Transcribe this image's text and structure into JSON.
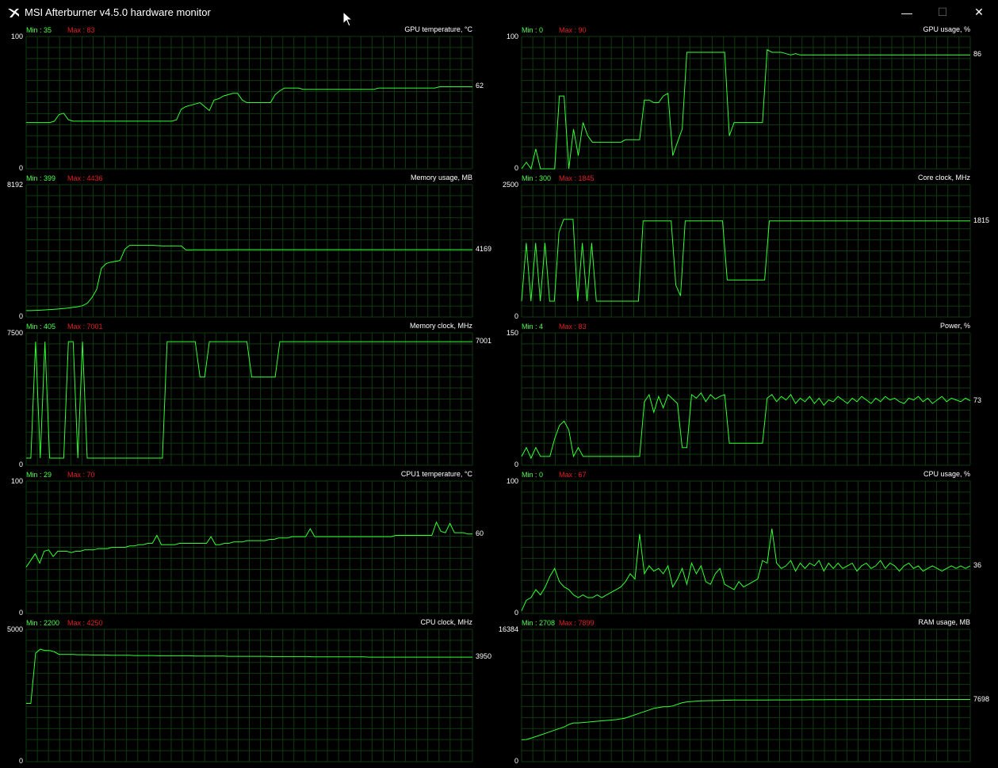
{
  "window": {
    "title": "MSI Afterburner v4.5.0 hardware monitor",
    "controls": {
      "minimize": "—",
      "maximize": "☐",
      "close": "✕"
    },
    "icon": "afterburner-logo-icon"
  },
  "colors": {
    "line": "#33ff33",
    "grid": "#0f3a0f",
    "min": "#4cff4c",
    "max": "#e02020",
    "text": "#ffffff",
    "background": "#000000"
  },
  "graphs": [
    {
      "name": "GPU temperature, °C",
      "min_label": "Min : 35",
      "max_label": "Max : 83",
      "y_max_label": "100",
      "y_min_label": "0",
      "current_label": "62",
      "y_max": 100,
      "samples": [
        35,
        35,
        35,
        35,
        35,
        35,
        36,
        41,
        42,
        37,
        36,
        36,
        36,
        36,
        36,
        36,
        36,
        36,
        36,
        36,
        36,
        36,
        36,
        36,
        36,
        36,
        36,
        36,
        36,
        36,
        36,
        36,
        37,
        45,
        47,
        48,
        49,
        50,
        47,
        44,
        52,
        53,
        55,
        56,
        57,
        57,
        52,
        50,
        50,
        50,
        50,
        50,
        50,
        56,
        59,
        61,
        61,
        61,
        61,
        60,
        60,
        60,
        60,
        60,
        60,
        60,
        60,
        60,
        60,
        60,
        60,
        60,
        60,
        60,
        60,
        61,
        61,
        61,
        61,
        61,
        61,
        61,
        61,
        61,
        61,
        61,
        61,
        61,
        62,
        62,
        62,
        62,
        62,
        62,
        62,
        62
      ]
    },
    {
      "name": "GPU usage, %",
      "min_label": "Min : 0",
      "max_label": "Max : 90",
      "y_max_label": "100",
      "y_min_label": "0",
      "current_label": "86",
      "y_max": 100,
      "samples": [
        0,
        5,
        0,
        15,
        0,
        0,
        0,
        0,
        55,
        55,
        0,
        30,
        10,
        35,
        25,
        20,
        20,
        20,
        20,
        20,
        20,
        20,
        22,
        22,
        22,
        22,
        52,
        52,
        50,
        50,
        55,
        57,
        10,
        20,
        30,
        88,
        88,
        88,
        88,
        88,
        88,
        88,
        88,
        88,
        25,
        35,
        35,
        35,
        35,
        35,
        35,
        35,
        90,
        88,
        88,
        88,
        87,
        86,
        87,
        86,
        86,
        86,
        86,
        86,
        86,
        86,
        86,
        86,
        86,
        86,
        86,
        86,
        86,
        86,
        86,
        86,
        86,
        86,
        86,
        86,
        86,
        86,
        86,
        86,
        86,
        86,
        86,
        86,
        86,
        86,
        86,
        86,
        86,
        86,
        86,
        86
      ]
    },
    {
      "name": "Memory usage, MB",
      "min_label": "Min : 399",
      "max_label": "Max : 4436",
      "y_max_label": "8192",
      "y_min_label": "0",
      "current_label": "4169",
      "y_max": 8192,
      "samples": [
        399,
        399,
        410,
        420,
        440,
        460,
        480,
        500,
        530,
        560,
        600,
        640,
        700,
        850,
        1200,
        1700,
        3000,
        3300,
        3400,
        3450,
        3500,
        4200,
        4436,
        4436,
        4436,
        4436,
        4436,
        4436,
        4420,
        4400,
        4400,
        4400,
        4400,
        4400,
        4160,
        4160,
        4165,
        4165,
        4165,
        4165,
        4165,
        4165,
        4165,
        4165,
        4168,
        4168,
        4168,
        4168,
        4169,
        4169,
        4169,
        4169,
        4169,
        4169,
        4169,
        4169,
        4169,
        4169,
        4169,
        4169,
        4169,
        4169,
        4169,
        4169,
        4169,
        4169,
        4169,
        4169,
        4169,
        4169,
        4169,
        4169,
        4169,
        4169,
        4169,
        4169,
        4169,
        4169,
        4169,
        4169,
        4169,
        4169,
        4169,
        4169,
        4169,
        4169,
        4169,
        4169,
        4169,
        4169,
        4169,
        4169,
        4169,
        4169,
        4169,
        4169
      ]
    },
    {
      "name": "Core clock, MHz",
      "min_label": "Min : 300",
      "max_label": "Max : 1845",
      "y_max_label": "2500",
      "y_min_label": "0",
      "current_label": "1815",
      "y_max": 2500,
      "samples": [
        300,
        1400,
        300,
        1400,
        300,
        1400,
        300,
        300,
        1600,
        1845,
        1845,
        1845,
        300,
        1400,
        300,
        1400,
        300,
        300,
        300,
        300,
        300,
        300,
        300,
        300,
        300,
        300,
        1815,
        1815,
        1815,
        1815,
        1815,
        1815,
        1815,
        600,
        400,
        1815,
        1815,
        1815,
        1815,
        1815,
        1815,
        1815,
        1815,
        1815,
        700,
        700,
        700,
        700,
        700,
        700,
        700,
        700,
        700,
        1815,
        1815,
        1815,
        1815,
        1815,
        1815,
        1815,
        1815,
        1815,
        1815,
        1815,
        1815,
        1815,
        1815,
        1815,
        1815,
        1815,
        1815,
        1815,
        1815,
        1815,
        1815,
        1815,
        1815,
        1815,
        1815,
        1815,
        1815,
        1815,
        1815,
        1815,
        1815,
        1815,
        1815,
        1815,
        1815,
        1815,
        1815,
        1815,
        1815,
        1815,
        1815,
        1815,
        1815
      ]
    },
    {
      "name": "Memory clock, MHz",
      "min_label": "Min : 405",
      "max_label": "Max : 7001",
      "y_max_label": "7500",
      "y_min_label": "0",
      "current_label": "7001",
      "y_max": 7500,
      "samples": [
        405,
        405,
        7001,
        405,
        7001,
        405,
        405,
        405,
        405,
        7001,
        7001,
        405,
        7001,
        405,
        405,
        405,
        405,
        405,
        405,
        405,
        405,
        405,
        405,
        405,
        405,
        405,
        405,
        405,
        405,
        405,
        7001,
        7001,
        7001,
        7001,
        7001,
        7001,
        7001,
        5000,
        5000,
        7001,
        7001,
        7001,
        7001,
        7001,
        7001,
        7001,
        7001,
        7001,
        5000,
        5000,
        5000,
        5000,
        5000,
        5000,
        7001,
        7001,
        7001,
        7001,
        7001,
        7001,
        7001,
        7001,
        7001,
        7001,
        7001,
        7001,
        7001,
        7001,
        7001,
        7001,
        7001,
        7001,
        7001,
        7001,
        7001,
        7001,
        7001,
        7001,
        7001,
        7001,
        7001,
        7001,
        7001,
        7001,
        7001,
        7001,
        7001,
        7001,
        7001,
        7001,
        7001,
        7001,
        7001,
        7001,
        7001,
        7001
      ]
    },
    {
      "name": "Power, %",
      "min_label": "Min : 4",
      "max_label": "Max : 83",
      "y_max_label": "150",
      "y_min_label": "0",
      "current_label": "73",
      "y_max": 150,
      "samples": [
        10,
        20,
        8,
        20,
        10,
        10,
        10,
        30,
        45,
        50,
        40,
        10,
        20,
        10,
        10,
        10,
        10,
        10,
        10,
        10,
        10,
        10,
        10,
        10,
        10,
        10,
        72,
        80,
        60,
        78,
        65,
        80,
        75,
        70,
        20,
        20,
        80,
        76,
        82,
        72,
        80,
        75,
        78,
        80,
        25,
        25,
        25,
        25,
        25,
        25,
        25,
        25,
        76,
        80,
        72,
        78,
        74,
        80,
        70,
        76,
        72,
        78,
        70,
        76,
        68,
        74,
        72,
        78,
        74,
        70,
        76,
        72,
        78,
        74,
        70,
        76,
        72,
        78,
        74,
        76,
        72,
        70,
        76,
        74,
        78,
        72,
        76,
        70,
        74,
        78,
        72,
        76,
        74,
        72,
        76,
        73
      ]
    },
    {
      "name": "CPU1 temperature, °C",
      "min_label": "Min : 29",
      "max_label": "Max : 70",
      "y_max_label": "100",
      "y_min_label": "0",
      "current_label": "60",
      "y_max": 100,
      "samples": [
        35,
        40,
        45,
        38,
        47,
        48,
        43,
        47,
        47,
        47,
        46,
        47,
        47,
        48,
        48,
        48,
        49,
        49,
        49,
        50,
        50,
        50,
        50,
        51,
        51,
        52,
        52,
        53,
        53,
        59,
        52,
        52,
        52,
        52,
        53,
        53,
        53,
        53,
        53,
        53,
        53,
        58,
        52,
        52,
        53,
        53,
        54,
        54,
        54,
        55,
        55,
        55,
        55,
        55,
        56,
        56,
        57,
        57,
        57,
        58,
        58,
        58,
        58,
        64,
        58,
        58,
        58,
        58,
        58,
        58,
        58,
        58,
        58,
        58,
        58,
        58,
        58,
        58,
        58,
        58,
        58,
        58,
        59,
        59,
        59,
        59,
        59,
        59,
        59,
        59,
        59,
        69,
        62,
        61,
        68,
        61,
        61,
        61,
        60,
        60
      ]
    },
    {
      "name": "CPU usage, %",
      "min_label": "Min : 0",
      "max_label": "Max : 67",
      "y_max_label": "100",
      "y_min_label": "0",
      "current_label": "36",
      "y_max": 100,
      "samples": [
        2,
        10,
        12,
        18,
        14,
        20,
        28,
        34,
        24,
        20,
        18,
        14,
        12,
        14,
        12,
        12,
        14,
        12,
        14,
        16,
        18,
        20,
        24,
        30,
        26,
        60,
        30,
        36,
        32,
        34,
        30,
        36,
        20,
        26,
        34,
        22,
        38,
        30,
        36,
        24,
        22,
        30,
        34,
        22,
        20,
        18,
        24,
        20,
        22,
        24,
        26,
        40,
        38,
        64,
        38,
        34,
        36,
        40,
        32,
        38,
        34,
        38,
        36,
        40,
        32,
        38,
        34,
        38,
        34,
        36,
        38,
        32,
        36,
        38,
        34,
        36,
        40,
        34,
        38,
        36,
        32,
        36,
        38,
        34,
        36,
        32,
        34,
        36,
        34,
        32,
        34,
        36,
        34,
        36,
        34,
        36
      ]
    },
    {
      "name": "CPU clock, MHz",
      "min_label": "Min : 2200",
      "max_label": "Max : 4250",
      "y_max_label": "5000",
      "y_min_label": "0",
      "current_label": "3950",
      "y_max": 5000,
      "samples": [
        2200,
        2200,
        4100,
        4250,
        4200,
        4200,
        4150,
        4050,
        4050,
        4050,
        4050,
        4040,
        4040,
        4040,
        4030,
        4030,
        4030,
        4030,
        4020,
        4020,
        4020,
        4020,
        4020,
        4010,
        4010,
        4010,
        4010,
        4010,
        4000,
        4000,
        4000,
        4000,
        4000,
        4000,
        4000,
        4000,
        3990,
        3990,
        3990,
        3990,
        3990,
        3990,
        3990,
        3980,
        3980,
        3980,
        3980,
        3980,
        3980,
        3980,
        3980,
        3980,
        3970,
        3970,
        3970,
        3970,
        3970,
        3970,
        3970,
        3970,
        3970,
        3960,
        3960,
        3960,
        3960,
        3960,
        3960,
        3960,
        3960,
        3960,
        3960,
        3960,
        3960,
        3950,
        3950,
        3950,
        3950,
        3950,
        3950,
        3950,
        3950,
        3950,
        3950,
        3950,
        3950,
        3950,
        3950,
        3950,
        3950,
        3950,
        3950,
        3950,
        3950,
        3950,
        3950,
        3950
      ]
    },
    {
      "name": "RAM usage, MB",
      "min_label": "Min : 2708",
      "max_label": "Max : 7899",
      "y_max_label": "16384",
      "y_min_label": "0",
      "current_label": "7698",
      "y_max": 16384,
      "samples": [
        2708,
        2750,
        2900,
        3100,
        3300,
        3500,
        3700,
        3900,
        4100,
        4300,
        4600,
        4800,
        4800,
        4850,
        4900,
        4950,
        5000,
        5050,
        5100,
        5150,
        5200,
        5300,
        5400,
        5600,
        5800,
        6000,
        6200,
        6400,
        6600,
        6700,
        6800,
        6800,
        6900,
        7100,
        7300,
        7400,
        7450,
        7500,
        7520,
        7540,
        7550,
        7560,
        7580,
        7600,
        7610,
        7620,
        7620,
        7620,
        7620,
        7620,
        7620,
        7630,
        7630,
        7640,
        7640,
        7640,
        7640,
        7640,
        7650,
        7650,
        7650,
        7660,
        7660,
        7660,
        7660,
        7670,
        7670,
        7670,
        7670,
        7670,
        7680,
        7680,
        7680,
        7680,
        7680,
        7690,
        7690,
        7690,
        7690,
        7690,
        7690,
        7698,
        7698,
        7698,
        7698,
        7698,
        7698,
        7698,
        7698,
        7698,
        7698,
        7698,
        7698,
        7698,
        7698,
        7698
      ]
    }
  ]
}
